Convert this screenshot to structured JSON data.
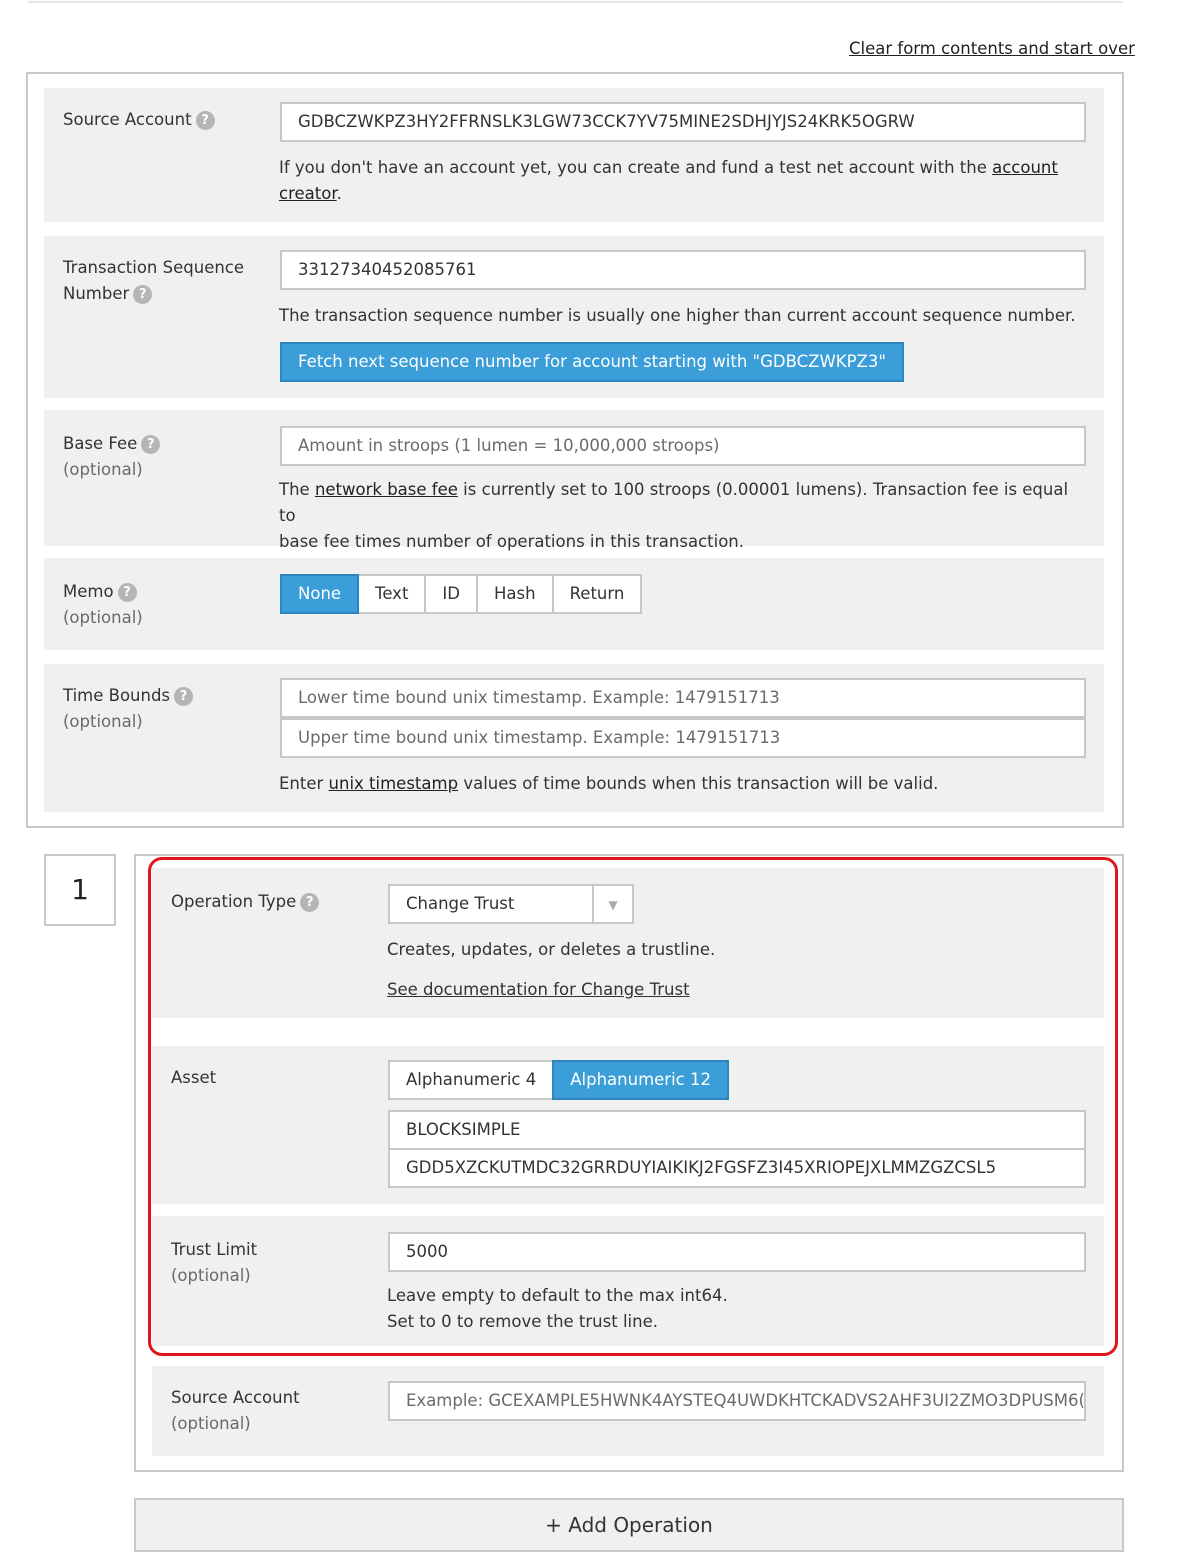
{
  "header": {
    "clear_link": "Clear form contents and start over"
  },
  "source_account": {
    "label": "Source Account",
    "value": "GDBCZWKPZ3HY2FFRNSLK3LGW73CCK7YV75MINE2SDHJYJS24KRK5OGRW",
    "note_prefix": "If you don't have an account yet, you can create and fund a test net account with the",
    "note_link_1": "account",
    "note_link_2": "creator",
    "note_suffix": "."
  },
  "sequence": {
    "label_line1": "Transaction Sequence",
    "label_line2": "Number",
    "value": "33127340452085761",
    "note": "The transaction sequence number is usually one higher than current account sequence number.",
    "fetch_button": "Fetch next sequence number for account starting with \"GDBCZWKPZ3\""
  },
  "base_fee": {
    "label": "Base Fee",
    "optional": "(optional)",
    "placeholder": "Amount in stroops (1 lumen = 10,000,000 stroops)",
    "note_prefix": "The",
    "note_link": "network base fee",
    "note_suffix": "is currently set to 100 stroops (0.00001 lumens). Transaction fee is equal to",
    "note_line2": "base fee times number of operations in this transaction."
  },
  "memo": {
    "label": "Memo",
    "optional": "(optional)",
    "options": [
      "None",
      "Text",
      "ID",
      "Hash",
      "Return"
    ],
    "selected": "None"
  },
  "time_bounds": {
    "label": "Time Bounds",
    "optional": "(optional)",
    "lower_placeholder": "Lower time bound unix timestamp. Example: 1479151713",
    "upper_placeholder": "Upper time bound unix timestamp.  Example: 1479151713",
    "note_prefix": "Enter",
    "note_link": "unix timestamp",
    "note_suffix": "values of time bounds when this transaction will be valid."
  },
  "operation": {
    "number": "1",
    "type_label": "Operation Type",
    "type_value": "Change Trust",
    "type_description": "Creates, updates, or deletes a trustline.",
    "doc_link": "See documentation for Change Trust",
    "asset": {
      "label": "Asset",
      "options": [
        "Alphanumeric 4",
        "Alphanumeric 12"
      ],
      "selected": "Alphanumeric 12",
      "code": "BLOCKSIMPLE",
      "issuer": "GDD5XZCKUTMDC32GRRDUYIAIKIKJ2FGSFZ3I45XRIOPEJXLMMZGZCSL5"
    },
    "trust_limit": {
      "label": "Trust Limit",
      "optional": "(optional)",
      "value": "5000",
      "note_line1": "Leave empty to default to the max int64.",
      "note_line2": "Set to 0 to remove the trust line."
    },
    "source_account": {
      "label": "Source Account",
      "optional": "(optional)",
      "placeholder": "Example: GCEXAMPLE5HWNK4AYSTEQ4UWDKHTCKADVS2AHF3UI2ZMO3DPUSM6("
    },
    "highlight_color": "#e0161d"
  },
  "add_operation": "+ Add Operation",
  "colors": {
    "accent": "#3b9ed8",
    "row_bg": "#f0f0f0",
    "border": "#c8c8c8"
  }
}
